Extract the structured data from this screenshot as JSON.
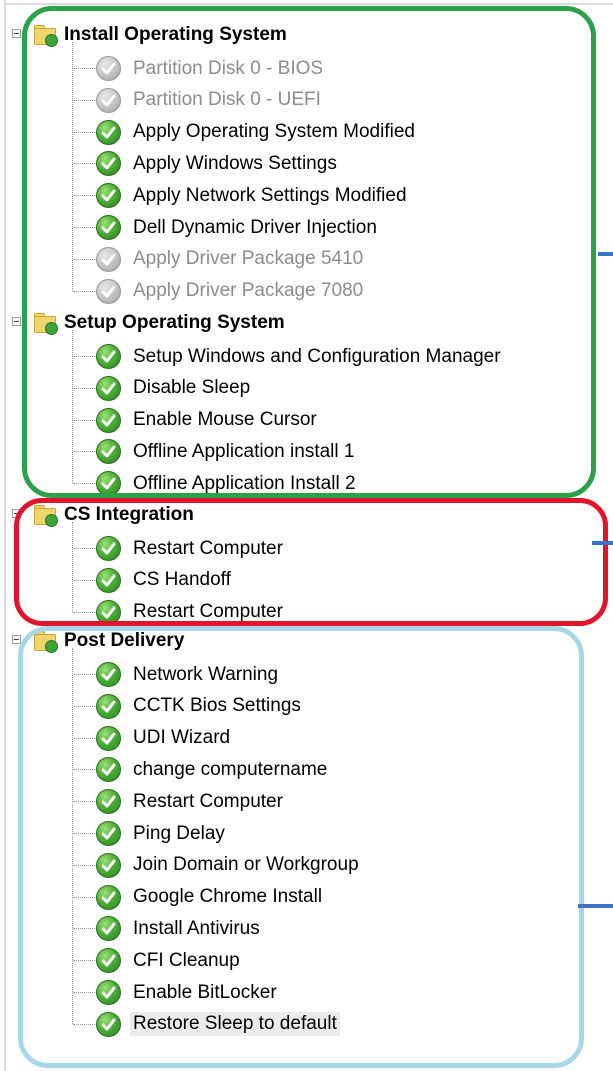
{
  "colors": {
    "group1_callout": "#2ba24a",
    "group2_callout": "#e0142b",
    "group3_callout": "#a8d8e6",
    "pointer": "#3a74c8",
    "disabled_text": "#8c8c8c"
  },
  "groups": [
    {
      "label": "Install Operating System",
      "icon": "folder-check-icon",
      "items": [
        {
          "label": "Partition Disk 0 - BIOS",
          "status": "disabled"
        },
        {
          "label": "Partition Disk 0 - UEFI",
          "status": "disabled"
        },
        {
          "label": "Apply Operating System Modified",
          "status": "success"
        },
        {
          "label": "Apply Windows Settings",
          "status": "success"
        },
        {
          "label": "Apply Network Settings Modified",
          "status": "success"
        },
        {
          "label": "Dell Dynamic Driver Injection",
          "status": "success"
        },
        {
          "label": "Apply Driver Package 5410",
          "status": "disabled"
        },
        {
          "label": "Apply Driver Package 7080",
          "status": "disabled"
        }
      ]
    },
    {
      "label": "Setup Operating System",
      "icon": "folder-check-icon",
      "items": [
        {
          "label": "Setup Windows and Configuration Manager",
          "status": "success"
        },
        {
          "label": "Disable Sleep",
          "status": "success"
        },
        {
          "label": "Enable Mouse Cursor",
          "status": "success"
        },
        {
          "label": "Offline Application install 1",
          "status": "success"
        },
        {
          "label": "Offline Application Install 2",
          "status": "success"
        }
      ]
    },
    {
      "label": "CS Integration",
      "icon": "folder-check-icon",
      "items": [
        {
          "label": "Restart Computer",
          "status": "success"
        },
        {
          "label": "CS Handoff",
          "status": "success"
        },
        {
          "label": "Restart Computer",
          "status": "success"
        }
      ]
    },
    {
      "label": "Post Delivery",
      "icon": "folder-check-icon",
      "items": [
        {
          "label": "Network Warning",
          "status": "success"
        },
        {
          "label": "CCTK Bios Settings",
          "status": "success"
        },
        {
          "label": "UDI Wizard",
          "status": "success"
        },
        {
          "label": "change computername",
          "status": "success"
        },
        {
          "label": "Restart Computer",
          "status": "success"
        },
        {
          "label": "Ping Delay",
          "status": "success"
        },
        {
          "label": "Join Domain or Workgroup",
          "status": "success"
        },
        {
          "label": "Google Chrome Install",
          "status": "success"
        },
        {
          "label": "Install Antivirus",
          "status": "success"
        },
        {
          "label": "CFI Cleanup",
          "status": "success"
        },
        {
          "label": "Enable BitLocker",
          "status": "success"
        },
        {
          "label": "Restore Sleep to default",
          "status": "success",
          "selected": true
        }
      ]
    }
  ]
}
